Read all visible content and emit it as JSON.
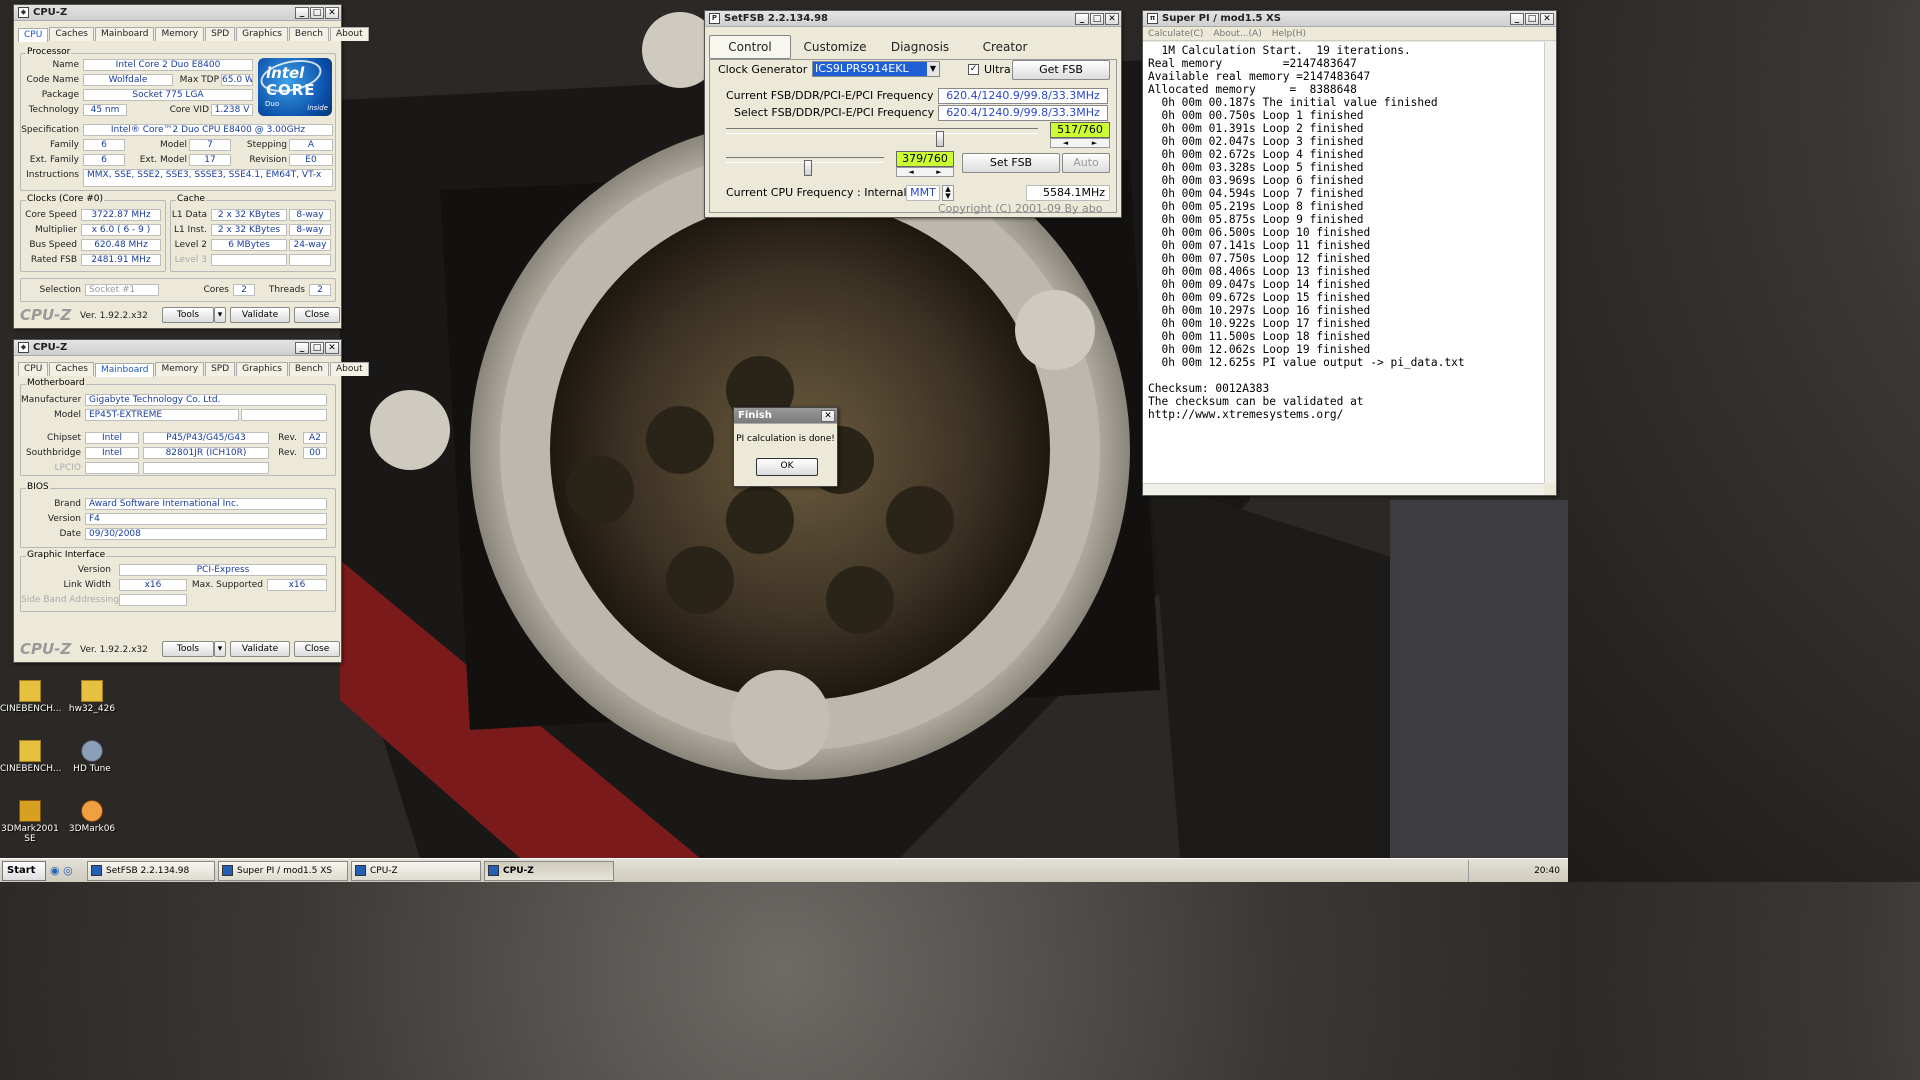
{
  "cpuz1": {
    "title": "CPU-Z",
    "tabs": [
      "CPU",
      "Caches",
      "Mainboard",
      "Memory",
      "SPD",
      "Graphics",
      "Bench",
      "About"
    ],
    "processor_label": "Processor",
    "name_label": "Name",
    "name": "Intel Core 2 Duo E8400",
    "codename_label": "Code Name",
    "codename": "Wolfdale",
    "tdp_label": "Max TDP",
    "tdp": "65.0 W",
    "package_label": "Package",
    "package": "Socket 775 LGA",
    "tech_label": "Technology",
    "tech": "45 nm",
    "vid_label": "Core VID",
    "vid": "1.238 V",
    "spec_label": "Specification",
    "spec": "Intel® Core™2 Duo CPU     E8400  @ 3.00GHz",
    "family_label": "Family",
    "family": "6",
    "model_label": "Model",
    "model": "7",
    "stepping_label": "Stepping",
    "stepping": "A",
    "extfamily_label": "Ext. Family",
    "extfamily": "6",
    "extmodel_label": "Ext. Model",
    "extmodel": "17",
    "revision_label": "Revision",
    "revision": "E0",
    "instr_label": "Instructions",
    "instr": "MMX, SSE, SSE2, SSE3, SSSE3, SSE4.1, EM64T, VT-x",
    "clocks_label": "Clocks (Core #0)",
    "cache_label": "Cache",
    "corespeed_label": "Core Speed",
    "corespeed": "3722.87 MHz",
    "multiplier_label": "Multiplier",
    "multiplier": "x 6.0 ( 6 - 9 )",
    "busspeed_label": "Bus Speed",
    "busspeed": "620.48 MHz",
    "ratedfsb_label": "Rated FSB",
    "ratedfsb": "2481.91 MHz",
    "l1d_label": "L1 Data",
    "l1d": "2 x 32 KBytes",
    "l1d_way": "8-way",
    "l1i_label": "L1 Inst.",
    "l1i": "2 x 32 KBytes",
    "l1i_way": "8-way",
    "l2_label": "Level 2",
    "l2": "6 MBytes",
    "l2_way": "24-way",
    "l3_label": "Level 3",
    "selection_label": "Selection",
    "selection": "Socket #1",
    "cores_label": "Cores",
    "cores": "2",
    "threads_label": "Threads",
    "threads": "2",
    "logo": "CPU-Z",
    "version": "Ver. 1.92.2.x32",
    "tools": "Tools",
    "validate": "Validate",
    "close": "Close",
    "intel_brand": "intel",
    "intel_core": "CORE",
    "intel_2": "2",
    "intel_duo": "Duo",
    "intel_inside": "inside"
  },
  "cpuz2": {
    "title": "CPU-Z",
    "tabs": [
      "CPU",
      "Caches",
      "Mainboard",
      "Memory",
      "SPD",
      "Graphics",
      "Bench",
      "About"
    ],
    "mb_label": "Motherboard",
    "manufacturer_label": "Manufacturer",
    "manufacturer": "Gigabyte Technology Co. Ltd.",
    "model_label": "Model",
    "model": "EP45T-EXTREME",
    "chipset_label": "Chipset",
    "chipset_vendor": "Intel",
    "chipset": "P45/P43/G45/G43",
    "chipset_rev_label": "Rev.",
    "chipset_rev": "A2",
    "south_label": "Southbridge",
    "south_vendor": "Intel",
    "south": "82801JR (ICH10R)",
    "south_rev_label": "Rev.",
    "south_rev": "00",
    "lpcio_label": "LPCIO",
    "bios_label": "BIOS",
    "brand_label": "Brand",
    "brand": "Award Software International Inc.",
    "version_label": "Version",
    "version_val": "F4",
    "date_label": "Date",
    "date": "09/30/2008",
    "gi_label": "Graphic Interface",
    "giver_label": "Version",
    "giver": "PCI-Express",
    "linkwidth_label": "Link Width",
    "linkwidth": "x16",
    "maxsup_label": "Max. Supported",
    "maxsup": "x16",
    "sideband_label": "Side Band Addressing",
    "logo": "CPU-Z",
    "version": "Ver. 1.92.2.x32",
    "tools": "Tools",
    "validate": "Validate",
    "close": "Close"
  },
  "setfsb": {
    "title": "SetFSB 2.2.134.98",
    "tabs": [
      "Control",
      "Customize",
      "Diagnosis",
      "Creator"
    ],
    "clockgen_label": "Clock Generator",
    "clockgen": "ICS9LPRS914EKL",
    "ultra_label": "Ultra",
    "getfsb": "Get FSB",
    "current_label": "Current FSB/DDR/PCI-E/PCI Frequency",
    "current": "620.4/1240.9/99.8/33.3MHz",
    "select_label": "Select FSB/DDR/PCI-E/PCI Frequency",
    "select": "620.4/1240.9/99.8/33.3MHz",
    "slider1": "517/760",
    "slider2": "379/760",
    "setfsb": "Set FSB",
    "auto": "Auto",
    "cpufreq_label": "Current CPU Frequency : Internal",
    "mmt": "MMT",
    "cpufreq": "5584.1MHz",
    "copyright": "Copyright (C) 2001-09 By abo"
  },
  "superpi": {
    "title": "Super PI / mod1.5 XS",
    "menu": [
      "Calculate(C)",
      "About...(A)",
      "Help(H)"
    ],
    "lines": [
      "  1M Calculation Start.  19 iterations.",
      "Real memory         =2147483647",
      "Available real memory =2147483647",
      "Allocated memory     =  8388648",
      "  0h 00m 00.187s The initial value finished",
      "  0h 00m 00.750s Loop 1 finished",
      "  0h 00m 01.391s Loop 2 finished",
      "  0h 00m 02.047s Loop 3 finished",
      "  0h 00m 02.672s Loop 4 finished",
      "  0h 00m 03.328s Loop 5 finished",
      "  0h 00m 03.969s Loop 6 finished",
      "  0h 00m 04.594s Loop 7 finished",
      "  0h 00m 05.219s Loop 8 finished",
      "  0h 00m 05.875s Loop 9 finished",
      "  0h 00m 06.500s Loop 10 finished",
      "  0h 00m 07.141s Loop 11 finished",
      "  0h 00m 07.750s Loop 12 finished",
      "  0h 00m 08.406s Loop 13 finished",
      "  0h 00m 09.047s Loop 14 finished",
      "  0h 00m 09.672s Loop 15 finished",
      "  0h 00m 10.297s Loop 16 finished",
      "  0h 00m 10.922s Loop 17 finished",
      "  0h 00m 11.500s Loop 18 finished",
      "  0h 00m 12.062s Loop 19 finished",
      "  0h 00m 12.625s PI value output -> pi_data.txt",
      "",
      "Checksum: 0012A383",
      "The checksum can be validated at",
      "http://www.xtremesystems.org/"
    ]
  },
  "dialog": {
    "title": "Finish",
    "message": "PI calculation is done!",
    "ok": "OK"
  },
  "desktop": {
    "icons": [
      "CINEBENCH...",
      "hw32_426",
      "CINEBENCH...",
      "HD Tune",
      "3DMark2001 SE",
      "3DMark06"
    ]
  },
  "taskbar": {
    "start": "Start",
    "buttons": [
      "SetFSB 2.2.134.98",
      "Super PI / mod1.5 XS",
      "CPU-Z",
      "CPU-Z"
    ],
    "clock": "20:40"
  },
  "colors": {
    "accent": "#2a47c8",
    "green": "#ccff33",
    "value_text": "#1a3d9c"
  }
}
